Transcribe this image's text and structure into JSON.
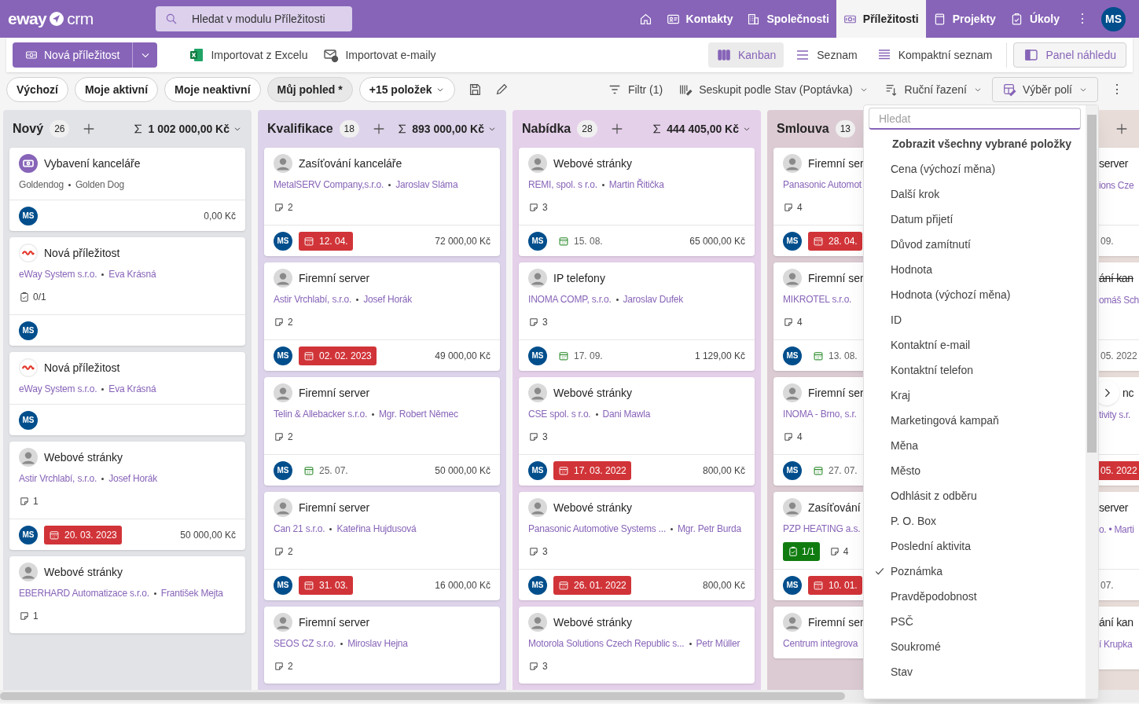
{
  "app": {
    "logo_left": "eway",
    "logo_right": "crm",
    "search": {
      "placeholder": "Hledat v modulu Příležitosti"
    },
    "nav": [
      {
        "kind": "home",
        "selected": false
      },
      {
        "kind": "contacts",
        "label": "Kontakty",
        "selected": false
      },
      {
        "kind": "companies",
        "label": "Společnosti",
        "selected": false
      },
      {
        "kind": "deals",
        "label": "Příležitosti",
        "selected": true
      },
      {
        "kind": "projects",
        "label": "Projekty",
        "selected": false
      },
      {
        "kind": "tasks",
        "label": "Úkoly",
        "selected": false
      }
    ],
    "more": "⋮",
    "user": "MS"
  },
  "commands": {
    "new": "Nová příležitost",
    "import_excel": "Importovat z Excelu",
    "import_email": "Importovat e-maily",
    "views": [
      {
        "kind": "kanban",
        "label": "Kanban",
        "selected": true
      },
      {
        "kind": "list",
        "label": "Seznam",
        "selected": false
      },
      {
        "kind": "compact",
        "label": "Kompaktní seznam",
        "selected": false
      }
    ],
    "preview": "Panel náhledu"
  },
  "filters": {
    "saved_views": [
      {
        "label": "Výchozí",
        "selected": false
      },
      {
        "label": "Moje aktivní",
        "selected": false
      },
      {
        "label": "Moje neaktivní",
        "selected": false
      },
      {
        "label": "Můj pohled *",
        "selected": true
      }
    ],
    "more_views": "+15 položek",
    "filter": "Filtr (1)",
    "group": "Seskupit podle Stav (Poptávka)",
    "sort": "Ruční řazení",
    "fields": "Výběr polí",
    "more": "⋮"
  },
  "columns": [
    {
      "name": "Nový",
      "count": "26",
      "sum": "1 002 000,00 Kč",
      "color": "#e2e3e7",
      "add_button": true,
      "cards": [
        {
          "kind": "app",
          "title": "Vybavení kanceláře",
          "company": "Goldendog",
          "contact": "Golden Dog",
          "links": false,
          "owner": "MS",
          "amount": "0,00 Kč"
        },
        {
          "kind": "logo",
          "title": "Nová příležitost",
          "company": "eWay System s.r.o.",
          "contact": "Eva Krásná",
          "links": true,
          "tasks": {
            "text": "0/1",
            "done": false
          },
          "owner": "MS"
        },
        {
          "kind": "logo",
          "title": "Nová příležitost",
          "company": "eWay System s.r.o.",
          "contact": "Eva Krásná",
          "links": true,
          "owner": "MS"
        },
        {
          "kind": "person",
          "title": "Webové stránky",
          "company": "Astir Vrchlabí, s.r.o.",
          "contact": "Josef Horák",
          "links": true,
          "notes": "1",
          "owner": "MS",
          "date": {
            "text": "20. 03. 2023",
            "overdue": true
          },
          "amount": "50 000,00 Kč"
        },
        {
          "kind": "person",
          "title": "Webové stránky",
          "company": "EBERHARD Automatizace s.r.o.",
          "contact": "František Mejta",
          "links": true,
          "notes": "1"
        }
      ]
    },
    {
      "name": "Kvalifikace",
      "count": "18",
      "sum": "893 000,00 Kč",
      "color": "#ddd3ea",
      "add_button": true,
      "cards": [
        {
          "kind": "person",
          "title": "Zasíťování kanceláře",
          "company": "MetalSERV Company,s.r.o.",
          "contact": "Jaroslav Sláma",
          "links": true,
          "notes": "2",
          "owner": "MS",
          "date": {
            "text": "12. 04.",
            "overdue": true
          },
          "amount": "72 000,00 Kč"
        },
        {
          "kind": "person",
          "title": "Firemní server",
          "company": "Astir Vrchlabí, s.r.o.",
          "contact": "Josef Horák",
          "links": true,
          "notes": "2",
          "owner": "MS",
          "date": {
            "text": "02. 02. 2023",
            "overdue": true
          },
          "amount": "49 000,00 Kč"
        },
        {
          "kind": "person",
          "title": "Firemní server",
          "company": "Telin & Allebacker s.r.o.",
          "contact": "Mgr. Robert Němec",
          "links": true,
          "notes": "2",
          "owner": "MS",
          "date": {
            "text": "25. 07.",
            "overdue": false
          },
          "amount": "50 000,00 Kč"
        },
        {
          "kind": "person",
          "title": "Firemní server",
          "company": "Can 21 s.r.o.",
          "contact": "Kateřina Hujdusová",
          "links": true,
          "notes": "2",
          "owner": "MS",
          "date": {
            "text": "31. 03.",
            "overdue": true
          },
          "amount": "16 000,00 Kč"
        },
        {
          "kind": "person",
          "title": "Firemní server",
          "company": "SEOS CZ s.r.o.",
          "contact": "Miroslav Hejna",
          "links": true,
          "notes": "2"
        }
      ]
    },
    {
      "name": "Nabídka",
      "count": "28",
      "sum": "444 405,00 Kč",
      "color": "#e5d0ea",
      "add_button": true,
      "cards": [
        {
          "kind": "person",
          "title": "Webové stránky",
          "company": "REMI, spol. s r.o.",
          "contact": "Martin Řitička",
          "links": true,
          "notes": "3",
          "owner": "MS",
          "date": {
            "text": "15. 08.",
            "overdue": false
          },
          "amount": "65 000,00 Kč"
        },
        {
          "kind": "person",
          "title": "IP telefony",
          "company": "INOMA COMP, s.r.o.",
          "contact": "Jaroslav Dufek",
          "links": true,
          "notes": "3",
          "owner": "MS",
          "date": {
            "text": "17. 09.",
            "overdue": false
          },
          "amount": "1 129,00 Kč"
        },
        {
          "kind": "person",
          "title": "Webové stránky",
          "company": "CSE spol. s r.o.",
          "contact": "Dani Mawla",
          "links": true,
          "notes": "3",
          "owner": "MS",
          "date": {
            "text": "17. 03. 2022",
            "overdue": true
          },
          "amount": "800,00 Kč"
        },
        {
          "kind": "person",
          "title": "Webové stránky",
          "company": "Panasonic Automotive Systems ...",
          "contact": "Mgr. Petr Burda",
          "links": true,
          "notes": "3",
          "owner": "MS",
          "date": {
            "text": "26. 01. 2022",
            "overdue": true
          },
          "amount": "800,00 Kč"
        },
        {
          "kind": "person",
          "title": "Webové stránky",
          "company": "Motorola Solutions Czech Republic s...",
          "contact": "Petr Müller",
          "links": true,
          "notes": "3"
        }
      ]
    },
    {
      "name": "Smlouva",
      "count": "13",
      "color": "#dccbd3",
      "add_button": false,
      "cards": [
        {
          "kind": "person",
          "title": "Firemní ser",
          "company": "Panasonic Automot",
          "links": true,
          "notes": "4",
          "owner": "MS",
          "date": {
            "text": "28. 04.",
            "overdue": true
          }
        },
        {
          "kind": "person",
          "title": "Firemní ser",
          "company": "MIKROTEL s.r.o.",
          "links": true,
          "notes": "4",
          "owner": "MS",
          "date": {
            "text": "13. 08.",
            "overdue": false
          }
        },
        {
          "kind": "person",
          "title": "Firemní ser",
          "company": "INOMA - Brno, s.r.",
          "links": true,
          "notes": "4",
          "owner": "MS",
          "date": {
            "text": "27. 07.",
            "overdue": false
          }
        },
        {
          "kind": "person",
          "title": "Zasíťování",
          "company": "PZP HEATING a.s.",
          "links": true,
          "tasks": {
            "text": "1/1",
            "done": true
          },
          "notes": "4",
          "owner": "MS",
          "date": {
            "text": "10. 01.",
            "overdue": true
          }
        },
        {
          "kind": "person",
          "title": "Firemní ser",
          "company": "Centrum integrova",
          "links": true
        }
      ]
    }
  ],
  "partial_column": {
    "color": "#e8dcd8",
    "add_button": true,
    "cards": [
      {
        "kind": "plain",
        "title": "server",
        "struck": false,
        "line": "ions Cze",
        "date": {
          "text": "09.",
          "overdue": false
        }
      },
      {
        "kind": "plain",
        "title": "ání kan",
        "struck": true,
        "line": "omáš Sch",
        "date": {
          "text": "05. 2022",
          "overdue": false
        }
      },
      {
        "kind": "scroll",
        "title": "nc",
        "struck": false,
        "line": "tivity s.r.",
        "date": {
          "text": "05. 2022",
          "overdue": true
        }
      },
      {
        "kind": "plain",
        "title": "server",
        "struck": false,
        "line": "o. • Marti",
        "date": {
          "text": "07.",
          "overdue": false
        }
      },
      {
        "kind": "plain",
        "title": "ání kan",
        "struck": false,
        "line": "í Krupka"
      }
    ]
  },
  "field_picker": {
    "search": {
      "placeholder": "Hledat"
    },
    "show_selected": "Zobrazit všechny vybrané položky",
    "items": [
      {
        "label": "Cena (výchozí měna)",
        "checked": false
      },
      {
        "label": "Další krok",
        "checked": false
      },
      {
        "label": "Datum přijetí",
        "checked": false
      },
      {
        "label": "Důvod zamítnutí",
        "checked": false
      },
      {
        "label": "Hodnota",
        "checked": false
      },
      {
        "label": "Hodnota (výchozí měna)",
        "checked": false
      },
      {
        "label": "ID",
        "checked": false
      },
      {
        "label": "Kontaktní e-mail",
        "checked": false
      },
      {
        "label": "Kontaktní telefon",
        "checked": false
      },
      {
        "label": "Kraj",
        "checked": false
      },
      {
        "label": "Marketingová kampaň",
        "checked": false
      },
      {
        "label": "Měna",
        "checked": false
      },
      {
        "label": "Město",
        "checked": false
      },
      {
        "label": "Odhlásit z odběru",
        "checked": false
      },
      {
        "label": "P. O. Box",
        "checked": false
      },
      {
        "label": "Poslední aktivita",
        "checked": false
      },
      {
        "label": "Poznámka",
        "checked": true
      },
      {
        "label": "Pravděpodobnost",
        "checked": false
      },
      {
        "label": "PSČ",
        "checked": false
      },
      {
        "label": "Soukromé",
        "checked": false
      },
      {
        "label": "Stav",
        "checked": false
      }
    ]
  }
}
